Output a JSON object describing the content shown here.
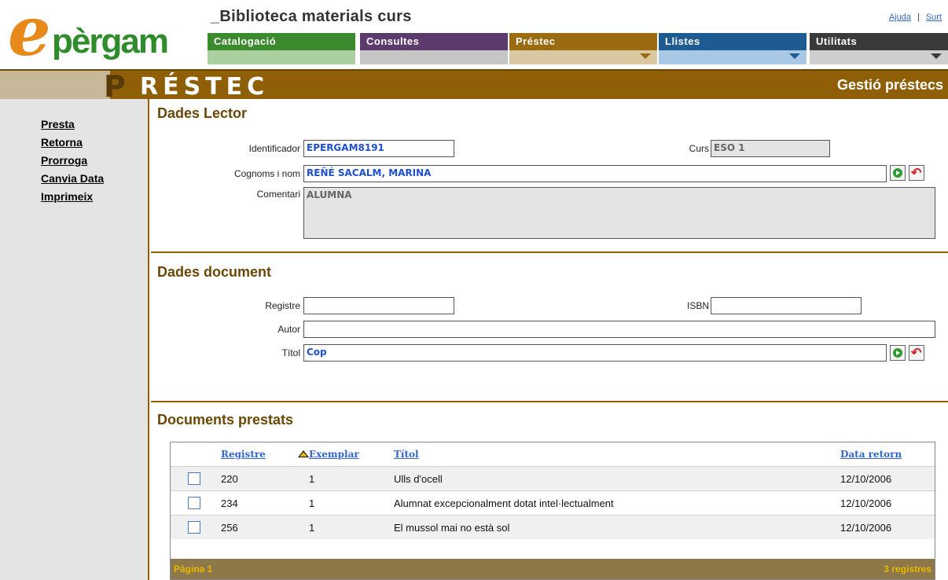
{
  "header": {
    "logo_first": "e",
    "logo_rest": "pèrgam",
    "app_title": "_Biblioteca materials curs",
    "links": {
      "help": "Ajuda",
      "separator": "|",
      "exit": "Surt"
    }
  },
  "menu": {
    "items": [
      {
        "label": "Catalogació"
      },
      {
        "label": "Consultes"
      },
      {
        "label": "Préstec"
      },
      {
        "label": "Llistes"
      },
      {
        "label": "Utilitats"
      }
    ]
  },
  "section": {
    "letter": "P",
    "title": "RÉSTEC",
    "subtitle": "Gestió préstecs"
  },
  "sidebar": {
    "items": [
      {
        "label": "Presta"
      },
      {
        "label": "Retorna"
      },
      {
        "label": "Prorroga"
      },
      {
        "label": "Canvia Data"
      },
      {
        "label": "Imprimeix"
      }
    ]
  },
  "reader": {
    "title": "Dades Lector",
    "id_label": "Identificador",
    "id_value": "EPERGAM8191",
    "course_label": "Curs",
    "course_value": "ESO 1",
    "name_label": "Cognoms i nom",
    "name_value": "REÑÉ SACALM, MARINA",
    "comment_label": "Comentari",
    "comment_value": "ALUMNA"
  },
  "document": {
    "title": "Dades document",
    "registre_label": "Registre",
    "registre_value": "",
    "isbn_label": "ISBN",
    "isbn_value": "",
    "author_label": "Autor",
    "author_value": "",
    "title_label": "Títol",
    "title_value": "Cop"
  },
  "loans": {
    "title": "Documents prestats",
    "columns": [
      "Registre",
      "Exemplar",
      "Títol",
      "Data retorn"
    ],
    "rows": [
      {
        "registre": "220",
        "exemplar": "1",
        "titol": "Ulls d'ocell",
        "data": "12/10/2006"
      },
      {
        "registre": "234",
        "exemplar": "1",
        "titol": "Alumnat excepcionalment dotat intel·lectualment",
        "data": "12/10/2006"
      },
      {
        "registre": "256",
        "exemplar": "1",
        "titol": "El mussol mai no està sol",
        "data": "12/10/2006"
      }
    ],
    "footer_left": "Pàgina 1",
    "footer_right": "3 registres"
  }
}
